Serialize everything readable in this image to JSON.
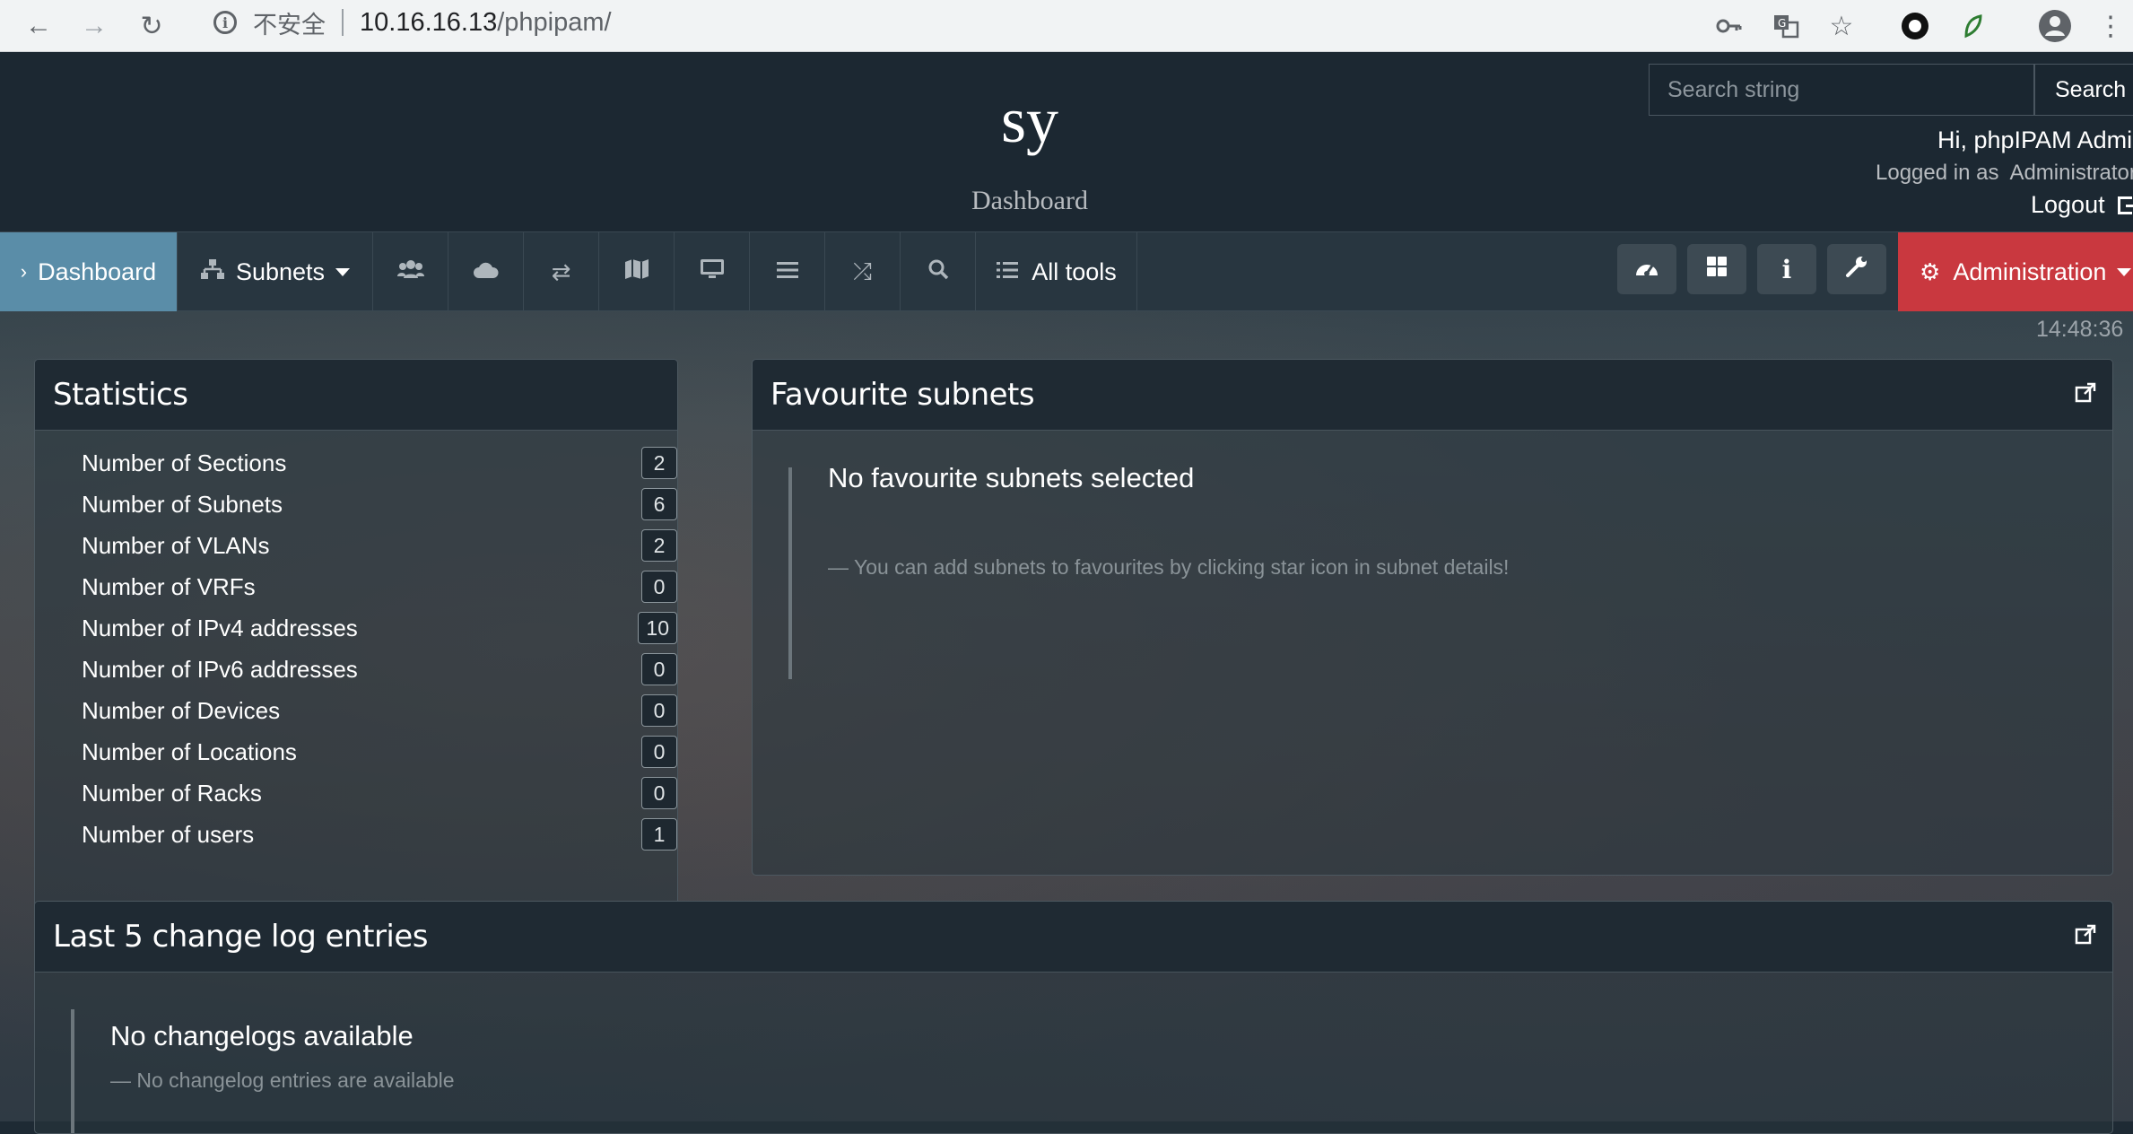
{
  "browser": {
    "insecure_label": "不安全",
    "url_host": "10.16.16.13",
    "url_path": "/phpipam/"
  },
  "header": {
    "site_title": "sy",
    "site_subtitle": "Dashboard",
    "search_placeholder": "Search string",
    "search_button": "Search",
    "greeting": "Hi, phpIPAM Admin",
    "logged_in_label": "Logged in as",
    "role": "Administrator",
    "logout": "Logout"
  },
  "nav": {
    "dashboard": "Dashboard",
    "subnets": "Subnets",
    "all_tools": "All tools",
    "administration": "Administration",
    "clock": "14:48:36"
  },
  "statistics": {
    "title": "Statistics",
    "rows": [
      {
        "label": "Number of Sections",
        "value": "2"
      },
      {
        "label": "Number of Subnets",
        "value": "6"
      },
      {
        "label": "Number of VLANs",
        "value": "2"
      },
      {
        "label": "Number of VRFs",
        "value": "0"
      },
      {
        "label": "Number of IPv4 addresses",
        "value": "10"
      },
      {
        "label": "Number of IPv6 addresses",
        "value": "0"
      },
      {
        "label": "Number of Devices",
        "value": "0"
      },
      {
        "label": "Number of Locations",
        "value": "0"
      },
      {
        "label": "Number of Racks",
        "value": "0"
      },
      {
        "label": "Number of users",
        "value": "1"
      }
    ]
  },
  "favourites": {
    "title": "Favourite subnets",
    "empty_title": "No favourite subnets selected",
    "empty_note": "— You can add subnets to favourites by clicking star icon in subnet details!"
  },
  "changelog": {
    "title": "Last 5 change log entries",
    "empty_title": "No changelogs available",
    "empty_note": "— No changelog entries are available"
  },
  "colors": {
    "active_tab": "#5a8da8",
    "admin_button": "#c9383f",
    "header_bg": "#1c2832"
  }
}
